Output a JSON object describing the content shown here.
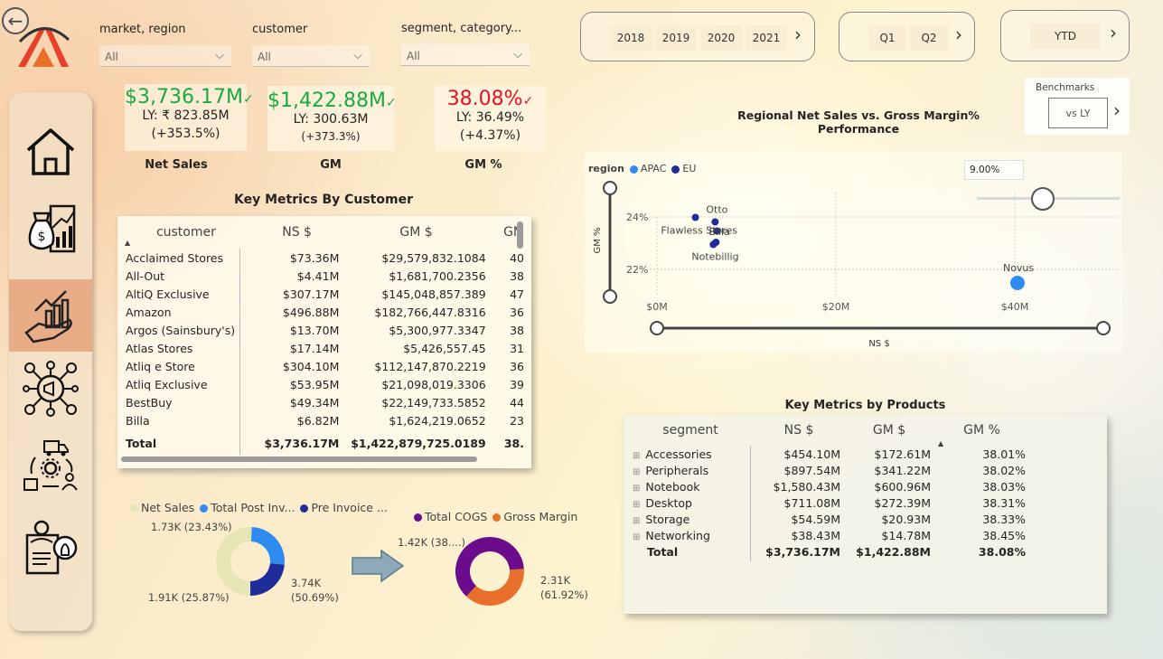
{
  "filters": [
    {
      "label": "market, region",
      "value": "All"
    },
    {
      "label": "customer",
      "value": "All"
    },
    {
      "label": "segment, category...",
      "value": "All"
    }
  ],
  "years": [
    "2018",
    "2019",
    "2020",
    "2021"
  ],
  "quarters": [
    "Q1",
    "Q2"
  ],
  "ytd_label": "YTD",
  "benchmarks": {
    "title": "Benchmarks",
    "value": "vs LY"
  },
  "kpis": [
    {
      "value": "$3,736.17M",
      "ly": "LY: ₹ 823.85M",
      "change": "(+353.5%)",
      "name": "Net Sales",
      "status": "up",
      "color": "#1AAB40"
    },
    {
      "value": "$1,422.88M",
      "ly": "LY: 300.63M",
      "change": "(+373.3%)",
      "name": "GM",
      "status": "up",
      "color": "#1AAB40"
    },
    {
      "value": "38.08%",
      "ly": "LY: 36.49%",
      "change": "(+4.37%)",
      "name": "GM %",
      "status": "up",
      "color": "#E81123"
    }
  ],
  "customer_table": {
    "title": "Key Metrics By Customer",
    "columns": [
      "customer",
      "NS $",
      "GM $",
      "GM"
    ],
    "rows": [
      [
        "Acclaimed Stores",
        "$73.36M",
        "$29,579,832.1084",
        "40"
      ],
      [
        "All-Out",
        "$4.41M",
        "$1,681,700.2356",
        "38"
      ],
      [
        "AltiQ Exclusive",
        "$307.17M",
        "$145,048,857.389",
        "47"
      ],
      [
        "Amazon",
        "$496.88M",
        "$182,766,447.8316",
        "36"
      ],
      [
        "Argos (Sainsbury's)",
        "$13.70M",
        "$5,300,977.3347",
        "38"
      ],
      [
        "Atlas Stores",
        "$17.14M",
        "$5,426,557.45",
        "31"
      ],
      [
        "Atliq e Store",
        "$304.10M",
        "$112,147,870.2219",
        "36"
      ],
      [
        "Atliq Exclusive",
        "$53.95M",
        "$21,098,019.3306",
        "39"
      ],
      [
        "BestBuy",
        "$49.34M",
        "$22,149,733.5852",
        "44"
      ],
      [
        "Billa",
        "$6.82M",
        "$1,624,219.0652",
        "23"
      ]
    ],
    "total": [
      "Total",
      "$3,736.17M",
      "$1,422,879,725.0189",
      "38."
    ]
  },
  "scatter": {
    "title": "Regional Net Sales vs. Gross Margin% Performance",
    "legend_title": "region",
    "slider_value": "9.00%",
    "ylabel": "GM %",
    "xlabel": "NS $",
    "y_ticks": [
      "24%",
      "22%"
    ],
    "x_ticks": [
      "$0M",
      "$20M",
      "$40M"
    ]
  },
  "chart_data": {
    "type": "scatter",
    "title": "Regional Net Sales vs. Gross Margin% Performance",
    "xlabel": "NS $",
    "ylabel": "GM %",
    "xlim": [
      0,
      40
    ],
    "ylim": [
      21.5,
      24.5
    ],
    "series": [
      {
        "name": "APAC",
        "color": "#2E8CF0",
        "points": [
          {
            "label": "Novus",
            "x": 40.3,
            "y": 21.5
          }
        ]
      },
      {
        "name": "EU",
        "color": "#1F2D9A",
        "points": [
          {
            "label": "Otto",
            "x": 6.5,
            "y": 24.2
          },
          {
            "label": "",
            "x": 4.3,
            "y": 24.4
          },
          {
            "label": "Flawless Stores",
            "x": 6.7,
            "y": 23.8
          },
          {
            "label": "Billa",
            "x": 6.6,
            "y": 23.3
          },
          {
            "label": "Notebillig",
            "x": 6.3,
            "y": 23.2
          }
        ]
      }
    ]
  },
  "donut1": {
    "legend": [
      {
        "name": "Net Sales",
        "color": "#E6E6B4"
      },
      {
        "name": "Total Post Inv...",
        "color": "#2E8CF0"
      },
      {
        "name": "Pre Invoice ...",
        "color": "#1F2D9A"
      }
    ],
    "slices": [
      {
        "name": "Net Sales",
        "value": 3.74,
        "pct": 50.69,
        "label": "3.74K (50.69%)",
        "color": "#E6E6B4"
      },
      {
        "name": "Total Post Inv...",
        "value": 1.91,
        "pct": 25.87,
        "label": "1.91K (25.87%)",
        "color": "#2E8CF0"
      },
      {
        "name": "Pre Invoice ...",
        "value": 1.73,
        "pct": 23.43,
        "label": "1.73K (23.43%)",
        "color": "#1F2D9A"
      }
    ]
  },
  "donut2": {
    "legend": [
      {
        "name": "Total COGS",
        "color": "#6A0C8C"
      },
      {
        "name": "Gross Margin",
        "color": "#E8702A"
      }
    ],
    "slices": [
      {
        "name": "Total COGS",
        "value": 2.31,
        "pct": 61.92,
        "label": "2.31K (61.92%)",
        "color": "#6A0C8C"
      },
      {
        "name": "Gross Margin",
        "value": 1.42,
        "pct": 38.08,
        "label": "1.42K (38....)",
        "color": "#E8702A"
      }
    ]
  },
  "product_table": {
    "title": "Key Metrics by Products",
    "columns": [
      "segment",
      "NS $",
      "GM $",
      "GM %"
    ],
    "rows": [
      [
        "Accessories",
        "$454.10M",
        "$172.61M",
        "38.01%"
      ],
      [
        "Peripherals",
        "$897.54M",
        "$341.22M",
        "38.02%"
      ],
      [
        "Notebook",
        "$1,580.43M",
        "$600.96M",
        "38.03%"
      ],
      [
        "Desktop",
        "$711.08M",
        "$272.39M",
        "38.31%"
      ],
      [
        "Storage",
        "$54.59M",
        "$20.93M",
        "38.33%"
      ],
      [
        "Networking",
        "$38.43M",
        "$14.78M",
        "38.45%"
      ]
    ],
    "total": [
      "Total",
      "$3,736.17M",
      "$1,422.88M",
      "38.08%"
    ]
  }
}
